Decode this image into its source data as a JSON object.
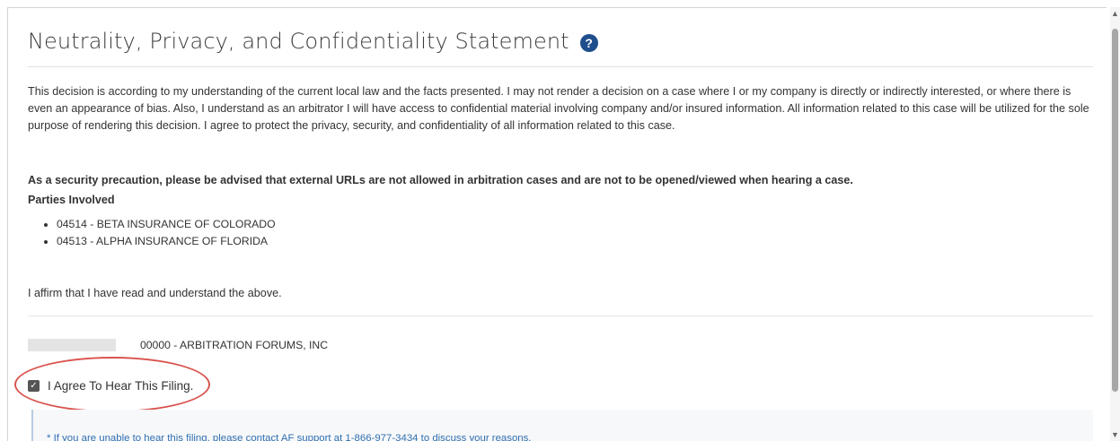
{
  "header": {
    "title": "Neutrality, Privacy, and Confidentiality Statement",
    "help_icon": "question-circle-icon",
    "help_glyph": "?"
  },
  "statement": {
    "paragraph": "This decision is according to my understanding of the current local law and the facts presented. I may not render a decision on a case where I or my company is directly or indirectly interested, or where there is even an appearance of bias. Also, I understand as an arbitrator I will have access to confidential material involving company and/or insured information. All information related to this case will be utilized for the sole purpose of rendering this decision. I agree to protect the privacy, security, and confidentiality of all information related to this case.",
    "warning": "As a security precaution, please be advised that external URLs are not allowed in arbitration cases and are not to be opened/viewed when hearing a case."
  },
  "parties": {
    "heading": "Parties Involved",
    "items": [
      "04514 - BETA INSURANCE OF COLORADO",
      "04513 - ALPHA INSURANCE OF FLORIDA"
    ]
  },
  "affirmation": "I affirm that I have read and understand the above.",
  "organization": {
    "name": "00000 - ARBITRATION FORUMS, INC"
  },
  "agree": {
    "label": "I Agree To Hear This Filing.",
    "checked": true,
    "check_glyph": "✓"
  },
  "notice": {
    "text": "* If you are unable to hear this filing, please contact AF support at 1-866-977-3434 to discuss your reasons."
  },
  "scrollbar": {
    "up_glyph": "▲",
    "down_glyph": "▼"
  },
  "colors": {
    "help_icon": "#1f4e8c",
    "highlight": "#d9534f",
    "notice_text": "#2f6fb0",
    "checkbox": "#555555"
  }
}
